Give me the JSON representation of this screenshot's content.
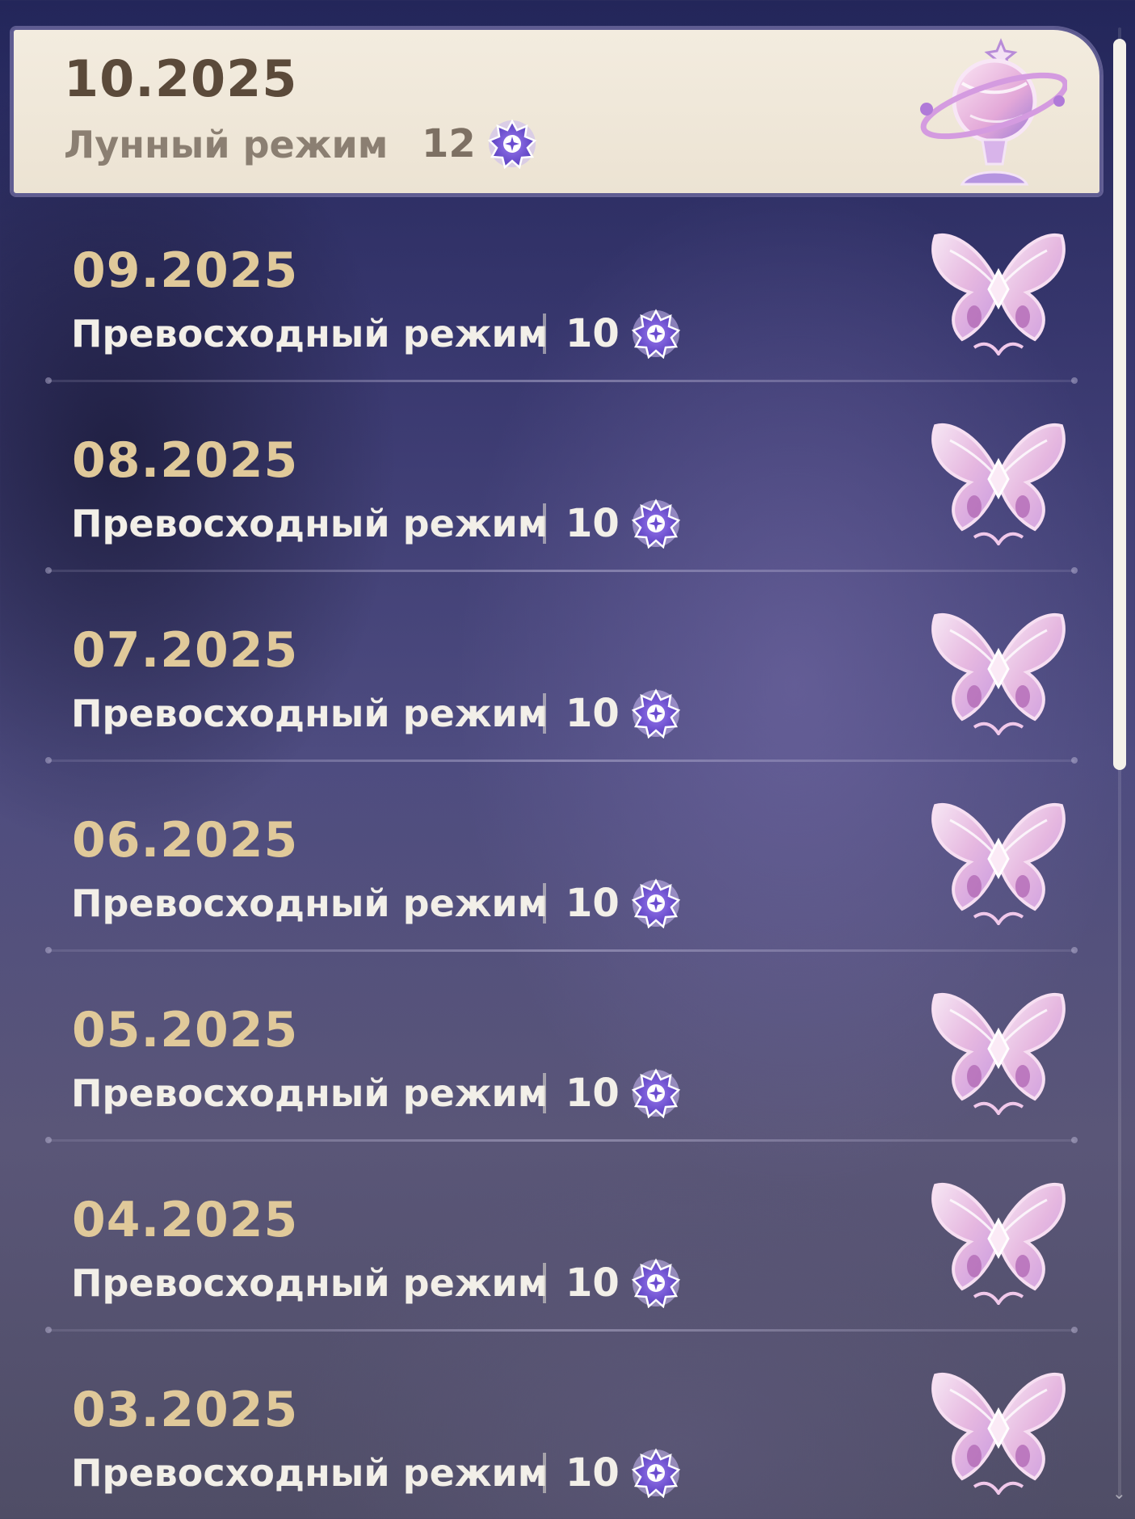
{
  "current": {
    "date": "10.2025",
    "mode": "Лунный режим",
    "stars": "12",
    "badge_icon": "trophy-globe-icon"
  },
  "history": [
    {
      "date": "09.2025",
      "mode": "Превосходный режим",
      "stars": "10",
      "badge_icon": "butterfly-icon"
    },
    {
      "date": "08.2025",
      "mode": "Превосходный режим",
      "stars": "10",
      "badge_icon": "butterfly-icon"
    },
    {
      "date": "07.2025",
      "mode": "Превосходный режим",
      "stars": "10",
      "badge_icon": "butterfly-icon"
    },
    {
      "date": "06.2025",
      "mode": "Превосходный режим",
      "stars": "10",
      "badge_icon": "butterfly-icon"
    },
    {
      "date": "05.2025",
      "mode": "Превосходный режим",
      "stars": "10",
      "badge_icon": "butterfly-icon"
    },
    {
      "date": "04.2025",
      "mode": "Превосходный режим",
      "stars": "10",
      "badge_icon": "butterfly-icon"
    },
    {
      "date": "03.2025",
      "mode": "Превосходный режим",
      "stars": "10",
      "badge_icon": "butterfly-icon"
    }
  ],
  "colors": {
    "card_bg": "#f3ecdf",
    "date_gold": "#e0c99a",
    "text_light": "#f2efe8",
    "star_purple": "#7a5bd6"
  }
}
